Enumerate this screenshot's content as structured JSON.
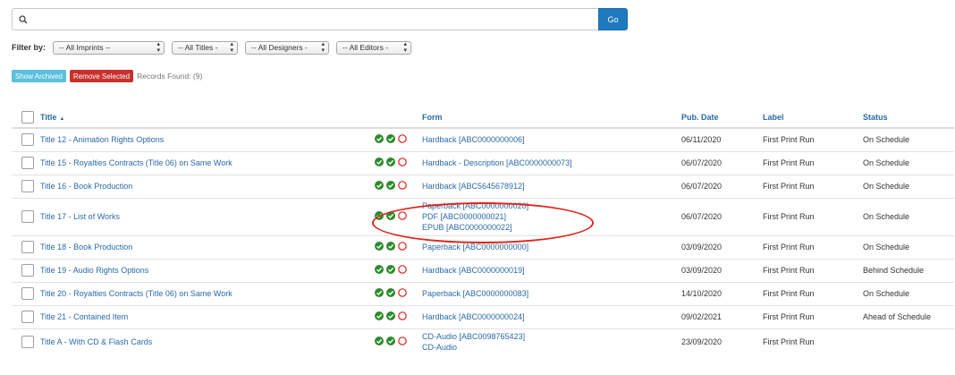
{
  "search": {
    "value": "",
    "placeholder": "",
    "go_label": "Go"
  },
  "filters": {
    "label": "Filter by:",
    "imprints": "-- All Imprints --",
    "titles": "-- All Titles -",
    "designers": "-- All Designers -",
    "editors": "-- All Editors -"
  },
  "actions": {
    "show_archived": "Show Archived",
    "remove_selected": "Remove Selected",
    "records_found": "Records Found: (9)"
  },
  "table": {
    "headers": {
      "title": "Title",
      "form": "Form",
      "pub_date": "Pub. Date",
      "label": "Label",
      "status": "Status"
    },
    "rows": [
      {
        "title": "Title 12 - Animation Rights Options",
        "forms": [
          "Hardback [ABC0000000006]"
        ],
        "pub_date": "06/11/2020",
        "label": "First Print Run",
        "status": "On Schedule"
      },
      {
        "title": "Title 15 - Royalties Contracts (Title 06) on Same Work",
        "forms": [
          "Hardback - Description [ABC0000000073]"
        ],
        "pub_date": "06/07/2020",
        "label": "First Print Run",
        "status": "On Schedule"
      },
      {
        "title": "Title 16 - Book Production",
        "forms": [
          "Hardback [ABC5645678912]"
        ],
        "pub_date": "06/07/2020",
        "label": "First Print Run",
        "status": "On Schedule"
      },
      {
        "title": "Title 17 - List of Works",
        "forms": [
          "Paperback [ABC0000000020]",
          "PDF [ABC0000000021]",
          "EPUB [ABC0000000022]"
        ],
        "pub_date": "06/07/2020",
        "label": "First Print Run",
        "status": "On Schedule"
      },
      {
        "title": "Title 18 - Book Production",
        "forms": [
          "Paperback [ABC0000000000]"
        ],
        "pub_date": "03/09/2020",
        "label": "First Print Run",
        "status": "On Schedule"
      },
      {
        "title": "Title 19 - Audio Rights Options",
        "forms": [
          "Hardback [ABC0000000019]"
        ],
        "pub_date": "03/09/2020",
        "label": "First Print Run",
        "status": "Behind Schedule"
      },
      {
        "title": "Title 20 - Royalties Contracts (Title 06) on Same Work",
        "forms": [
          "Paperback [ABC0000000083]"
        ],
        "pub_date": "14/10/2020",
        "label": "First Print Run",
        "status": "On Schedule"
      },
      {
        "title": "Title 21 - Contained Item",
        "forms": [
          "Hardback [ABC0000000024]"
        ],
        "pub_date": "09/02/2021",
        "label": "First Print Run",
        "status": "Ahead of Schedule"
      },
      {
        "title": "Title A - With CD & Flash Cards",
        "forms": [
          "CD-Audio [ABC0098765423]",
          "CD-Audio"
        ],
        "pub_date": "23/09/2020",
        "label": "First Print Run",
        "status": ""
      }
    ]
  },
  "colors": {
    "link": "#2a6aa8",
    "go": "#1f79bf",
    "archived": "#5bc0de",
    "remove": "#c9302c",
    "ok": "#2e8b2e",
    "pending": "#e0231a"
  },
  "icons": {
    "status_ok": "check-circle-icon",
    "status_pending": "empty-circle-icon",
    "search": "search-icon",
    "sort": "sort-ascending-icon"
  }
}
